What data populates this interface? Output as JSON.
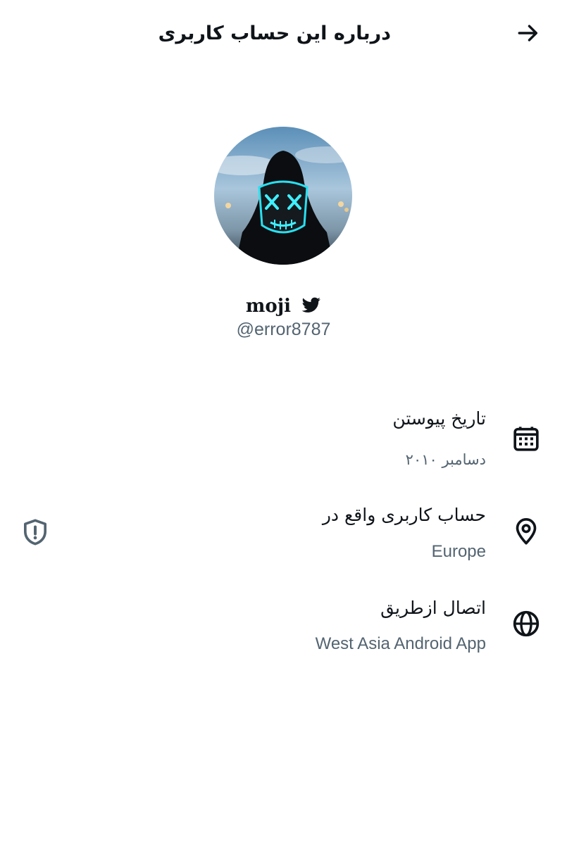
{
  "header": {
    "title": "درباره این حساب کاربری",
    "back_icon": "arrow-right-icon"
  },
  "profile": {
    "display_name": "moji",
    "handle": "@error8787",
    "badge_icon": "twitter-bird-icon"
  },
  "details": [
    {
      "icon": "calendar-icon",
      "label": "تاریخ پیوستن",
      "value": "دسامبر ۲۰۱۰"
    },
    {
      "icon": "location-pin-icon",
      "label": "حساب کاربری واقع در",
      "value": "Europe"
    },
    {
      "icon": "globe-icon",
      "label": "اتصال ازطریق",
      "value": "West Asia Android App"
    }
  ],
  "side_icons": {
    "shield": "shield-alert-icon"
  },
  "colors": {
    "primary_text": "#0f1419",
    "secondary_text": "#536471",
    "icon": "#0f1419"
  }
}
